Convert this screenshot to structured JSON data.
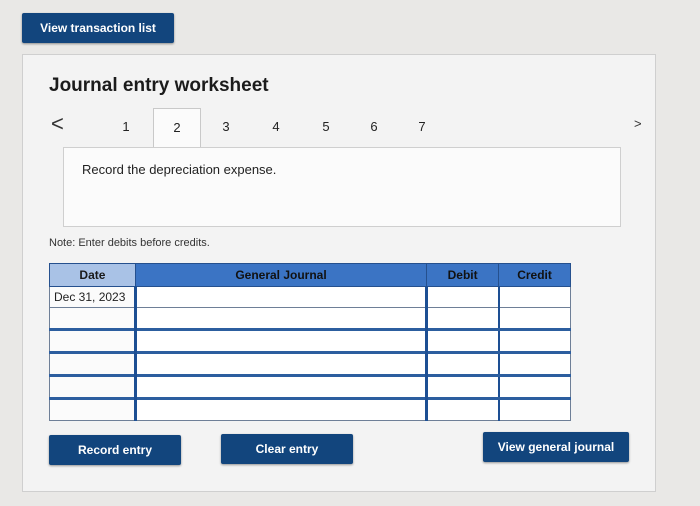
{
  "header": {
    "view_transactions_label": "View transaction list"
  },
  "worksheet": {
    "title": "Journal entry worksheet",
    "nav_prev_symbol": "<",
    "nav_next_symbol": ">",
    "tabs": [
      "1",
      "2",
      "3",
      "4",
      "5",
      "6",
      "7"
    ],
    "active_tab": 2,
    "instruction": "Record the depreciation expense.",
    "note": "Note: Enter debits before credits."
  },
  "journal": {
    "columns": [
      "Date",
      "General Journal",
      "Debit",
      "Credit"
    ],
    "rows": [
      {
        "date": "Dec 31, 2023"
      },
      {
        "date": ""
      },
      {
        "date": ""
      },
      {
        "date": ""
      },
      {
        "date": ""
      },
      {
        "date": ""
      }
    ]
  },
  "actions": {
    "record_label": "Record entry",
    "clear_label": "Clear entry",
    "view_journal_label": "View general journal"
  },
  "colors": {
    "primary_button": "#12457d",
    "header_blue": "#3b74c4"
  }
}
